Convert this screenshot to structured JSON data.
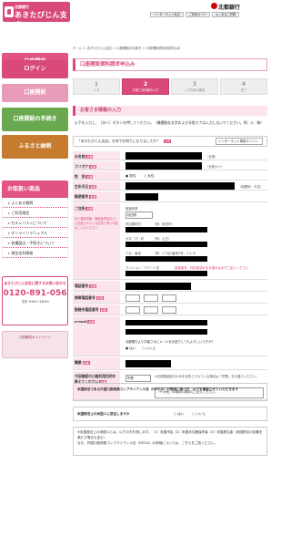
{
  "header": {
    "bank_small": "北都銀行",
    "branch_name": "あきたびじん支店",
    "nav": [
      "インターネット支店",
      "ご利用ガイド",
      "よくあるご質問"
    ],
    "brand": "北都銀行"
  },
  "sidebar": {
    "buttons": [
      {
        "label": "口座開設",
        "color": "#e05384"
      },
      {
        "label": "ログイン",
        "color": "#d9497a"
      },
      {
        "label": "口座開設",
        "color": "#e89bb8"
      },
      {
        "label": "口座開設の手続き",
        "color": "#6aa84f"
      },
      {
        "label": "ふるさと納税",
        "color": "#c77b2e"
      }
    ],
    "menu_title": "お取扱い商品",
    "menu_items": [
      "よくある質問",
      "ご利用規定",
      "セキュリティについて",
      "オンラインマニュアル",
      "各種届出・手続きについて",
      "預金金利情報"
    ],
    "phone_title": "あきたびじん支店に関するお問い合わせ",
    "phone_number": "0120-891-056",
    "phone_hours": "平日 9:00〜18:00",
    "ad_text": "口座開設キャンペーン"
  },
  "main": {
    "breadcrumb": "ホーム ＞ あきたびじん支店 ＞ 口座開設の手続き ＞ 口座開設資料請求申込み",
    "title": "口座開設資料請求申込み",
    "steps": [
      {
        "num": "1",
        "label": "入力"
      },
      {
        "num": "2",
        "label": "お客さま情報の入力"
      },
      {
        "num": "3",
        "label": "入力内容の確認"
      },
      {
        "num": "4",
        "label": "完了"
      }
    ],
    "section_head": "お客さま情報の入力",
    "intro": "以下を入力し、［次へ］ボタンを押してください。（機種依存文字および半角カナは入力しないでください。例：①、㈱）",
    "question_label": "「あきたびじん支店」を何でお知りになりましたか？",
    "question_value": "インターネット検索エンジン",
    "fields": {
      "name_label": "お名前",
      "name_note": "（全角）",
      "kana_label": "フリガナ",
      "kana_note": "（全角カナ）",
      "gender_label": "性　別",
      "gender_male": "男性",
      "gender_female": "女性",
      "birth_label": "生年月日",
      "birth_note": "（和暦例：平成）",
      "zip_label": "郵便番号",
      "address_label": "ご住所",
      "address_note": "本人確認書類（運転免許証など）に記載されている住所と同じ内容をご入力ください",
      "pref_label": "都道府県",
      "pref_value": "秋田県",
      "city_label": "市区郡町村",
      "city_note": "（例：秋田市）",
      "street_label": "大字・字・町",
      "street_note": "（例：山王）",
      "chome_label": "丁目・番地",
      "chome_note": "（例：1丁目2番地3号、1-2-3）",
      "bldg_label": "マンション・アパート名",
      "bldg_note": "部屋番号、特記事項がある場合は必ずご記入ください",
      "phone_label": "電話番号",
      "mobile_label": "携帯電話番号",
      "work_label": "勤務先電話番号",
      "email_label": "e-mail",
      "email_q": "北都銀行よりお客さまにメールをお送りしてもよろしいですか？",
      "email_yes": "はい",
      "email_no": "いいえ",
      "job_label": "職業",
      "reason_label": "今回開設の口座利用目的を教えてください",
      "reason_value": "貯蓄",
      "reason_note": "※定期預金取引のみを目的とされている場合は「貯蓄」をお選びください。",
      "reason_other": "「その他」の場合の場合のご記入ください。"
    },
    "fatca_title": "米国税法である外国口座税務コンプライアンス法（FATCA）の規定に基づき、以下を確認させていただきます",
    "fatca_q": "米国税法上の米国人に該当しますか",
    "fatca_yes": "はい",
    "fatca_no": "いいえ",
    "fatca_detail": "※米国税法上の米国人とは、以下の方を指します。（1）米国市民（2）米国永住権保有者（3）米国居住者（米国税法の定義を満たす場合も含む）",
    "fatca_link": "なお、外国口座税務コンプライアンス法（FATCA）の詳細については、こちらをご覧ください。"
  }
}
